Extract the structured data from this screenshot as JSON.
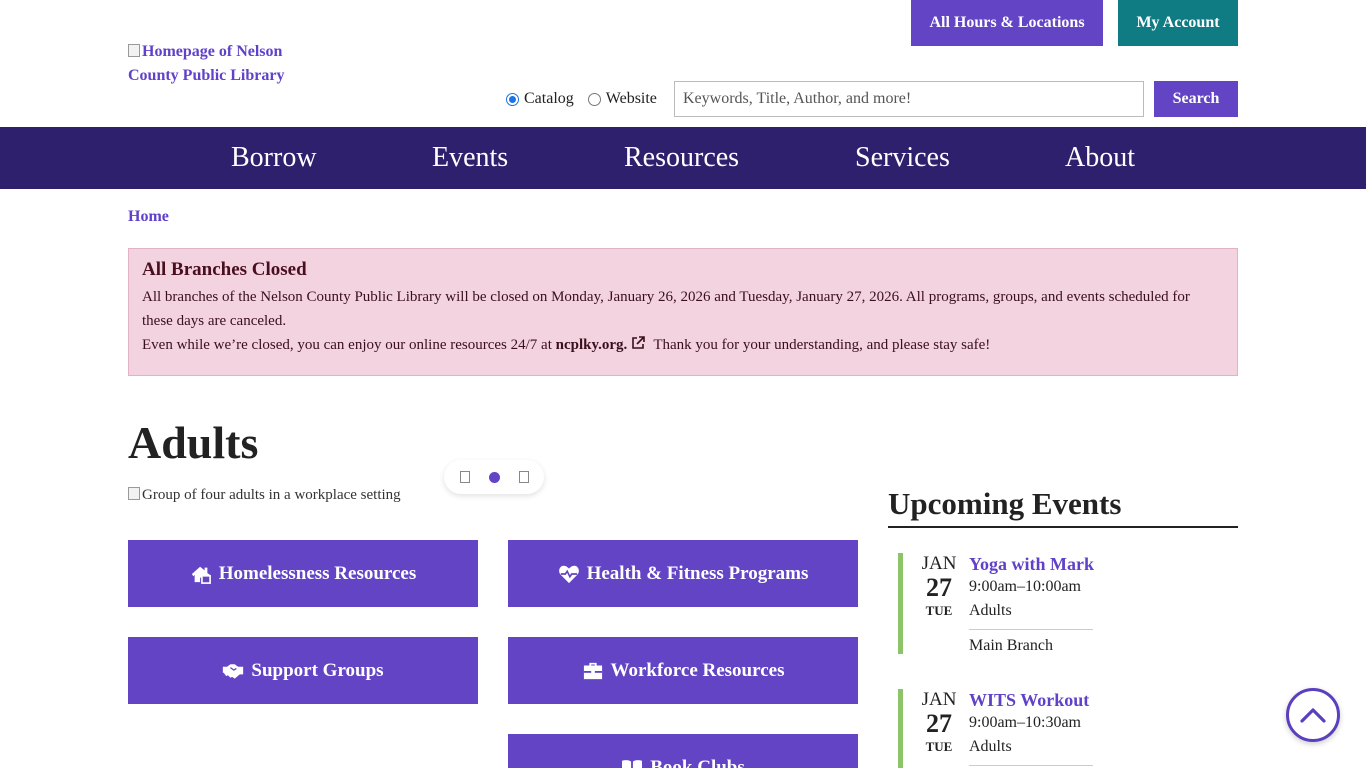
{
  "header": {
    "logo_alt": "Homepage of Nelson County Public Library",
    "hours_button": "All Hours & Locations",
    "account_button": "My Account"
  },
  "search": {
    "option_catalog": "Catalog",
    "option_website": "Website",
    "selected": "Catalog",
    "placeholder": "Keywords, Title, Author, and more!",
    "button": "Search"
  },
  "nav": {
    "items": [
      "Borrow",
      "Events",
      "Resources",
      "Services",
      "About"
    ]
  },
  "breadcrumb": {
    "home": "Home"
  },
  "alert": {
    "title": "All Branches Closed",
    "line1": "All branches of the Nelson County Public Library will be closed on Monday, January 26, 2026 and Tuesday, January 27, 2026. All programs, groups, and events scheduled for these days are canceled.",
    "line2_prefix": "Even while we’re closed, you can enjoy our online resources 24/7 at",
    "line2_link": "ncplky.org.",
    "line2_suffix": "Thank you for your understanding, and please stay safe!"
  },
  "page": {
    "title": "Adults",
    "hero_alt": "Group of four adults in a workplace setting"
  },
  "tiles": [
    {
      "label": "Homelessness Resources",
      "icon": "home-icon"
    },
    {
      "label": "Health & Fitness Programs",
      "icon": "heart-pulse-icon"
    },
    {
      "label": "Support Groups",
      "icon": "handshake-icon"
    },
    {
      "label": "Workforce Resources",
      "icon": "briefcase-icon"
    },
    {
      "label": "Book Clubs",
      "icon": "book-icon"
    }
  ],
  "events": {
    "heading": "Upcoming Events",
    "items": [
      {
        "month": "JAN",
        "day": "27",
        "weekday": "TUE",
        "title": "Yoga with Mark",
        "time": "9:00am–10:00am",
        "audience": "Adults",
        "location": "Main Branch"
      },
      {
        "month": "JAN",
        "day": "27",
        "weekday": "TUE",
        "title": "WITS Workout",
        "time": "9:00am–10:30am",
        "audience": "Adults"
      }
    ]
  },
  "colors": {
    "primary_purple": "#6244c5",
    "nav_dark": "#2f206d",
    "teal": "#0f7b83",
    "alert_bg": "#f3d3df",
    "event_bar": "#8cc46a"
  }
}
